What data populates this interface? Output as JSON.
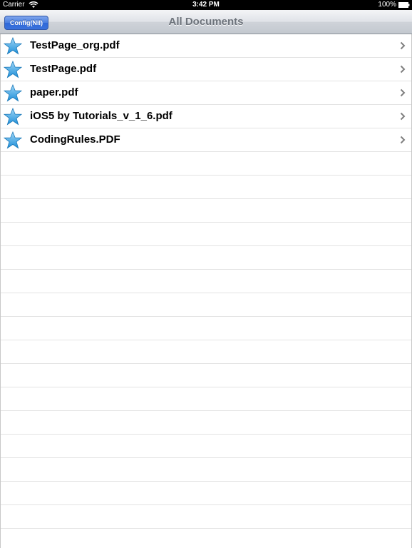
{
  "status_bar": {
    "carrier": "Carrier",
    "time": "3:42 PM",
    "battery": "100%"
  },
  "nav_bar": {
    "title": "All Documents",
    "config_button": "Config(Nil)"
  },
  "documents": [
    {
      "name": "TestPage_org.pdf",
      "icon": "star-icon"
    },
    {
      "name": "TestPage.pdf",
      "icon": "star-icon"
    },
    {
      "name": "paper.pdf",
      "icon": "star-icon"
    },
    {
      "name": "iOS5 by Tutorials_v_1_6.pdf",
      "icon": "star-icon"
    },
    {
      "name": "CodingRules.PDF",
      "icon": "star-icon"
    }
  ],
  "colors": {
    "star": "#3aa0e0",
    "button": "#3a72dc",
    "title": "#6d737b"
  }
}
